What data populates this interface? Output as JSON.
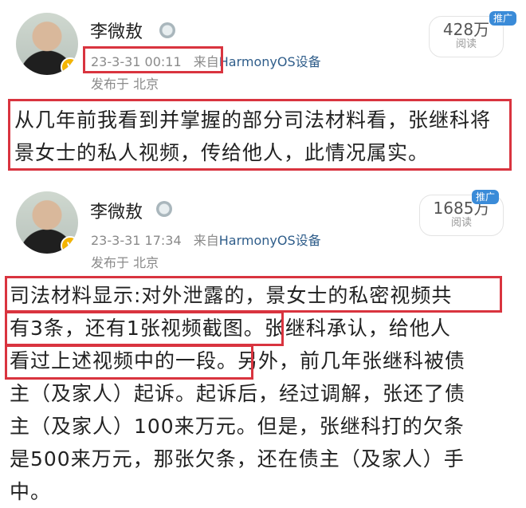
{
  "posts": [
    {
      "author": "李微敖",
      "timestamp": "23-3-31 00:11",
      "source_prefix": "来自",
      "source": "HarmonyOS设备",
      "location": "发布于 北京",
      "read_count": "428万",
      "read_label": "阅读",
      "promo_label": "推广",
      "verified_icon": "verified-badge-icon",
      "text": "从几年前我看到并掌握的部分司法材料看，张继科将景女士的私人视频，传给他人，此情况属实。"
    },
    {
      "author": "李微敖",
      "timestamp": "23-3-31 17:34",
      "source_prefix": "来自",
      "source": "HarmonyOS设备",
      "location": "发布于 北京",
      "read_count": "1685万",
      "read_label": "阅读",
      "promo_label": "推广",
      "verified_icon": "verified-badge-icon",
      "text_lines": [
        "司法材料显示:对外泄露的，景女士的私密视频共",
        "有3条，还有1张视频截图。张继科承认，给他人",
        "看过上述视频中的一段。另外，前几年张继科被债",
        "主（及家人）起诉。起诉后，经过调解，张还了债",
        "主（及家人）100来万元。但是，张继科打的欠条",
        "是500来万元，那张欠条，还在债主（及家人）手",
        "中。"
      ]
    }
  ],
  "colors": {
    "highlight_box": "#d9343f",
    "source_link": "#2f5d8a",
    "promo_badge": "#3a8bd8",
    "meta_text": "#8a8a8a"
  }
}
